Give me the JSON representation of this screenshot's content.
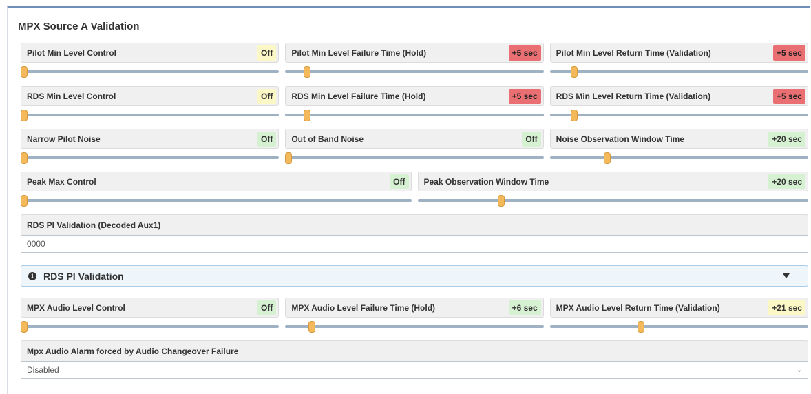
{
  "section": {
    "title": "MPX Source A Validation"
  },
  "rows": [
    [
      {
        "label": "Pilot Min Level Control",
        "value": "Off",
        "status": "yellow",
        "level": 0.0
      },
      {
        "label": "Pilot Min Level Failure Time (Hold)",
        "value": "+5 sec",
        "status": "red",
        "level": 0.07
      },
      {
        "label": "Pilot Min Level Return Time (Validation)",
        "value": "+5 sec",
        "status": "red",
        "level": 0.08
      }
    ],
    [
      {
        "label": "RDS Min Level Control",
        "value": "Off",
        "status": "yellow",
        "level": 0.0
      },
      {
        "label": "RDS Min Level Failure Time (Hold)",
        "value": "+5 sec",
        "status": "red",
        "level": 0.07
      },
      {
        "label": "RDS Min Level Return Time (Validation)",
        "value": "+5 sec",
        "status": "red",
        "level": 0.08
      }
    ],
    [
      {
        "label": "Narrow Pilot Noise",
        "value": "Off",
        "status": "green",
        "level": 0.0
      },
      {
        "label": "Out of Band Noise",
        "value": "Off",
        "status": "green",
        "level": 0.0
      },
      {
        "label": "Noise Observation Window Time",
        "value": "+20 sec",
        "status": "green",
        "level": 0.21
      }
    ],
    [
      {
        "label": "Peak Max Control",
        "value": "Off",
        "status": "green",
        "level": 0.0
      },
      {
        "label": "Peak Observation Window Time",
        "value": "+20 sec",
        "status": "green",
        "level": 0.205
      }
    ]
  ],
  "rds_pi": {
    "label": "RDS PI Validation (Decoded Aux1)",
    "value": "0000"
  },
  "info_bar": {
    "label": "RDS PI Validation",
    "icon": "info-circle-icon"
  },
  "audio_row": [
    {
      "label": "MPX Audio Level Control",
      "value": "Off",
      "status": "green",
      "level": 0.0
    },
    {
      "label": "MPX Audio Level Failure Time (Hold)",
      "value": "+6 sec",
      "status": "green",
      "level": 0.09
    },
    {
      "label": "MPX Audio Level Return Time (Validation)",
      "value": "+21 sec",
      "status": "yellow",
      "level": 0.34
    }
  ],
  "changeover": {
    "label": "Mpx Audio Alarm forced by Audio Changeover Failure",
    "value": "Disabled"
  }
}
